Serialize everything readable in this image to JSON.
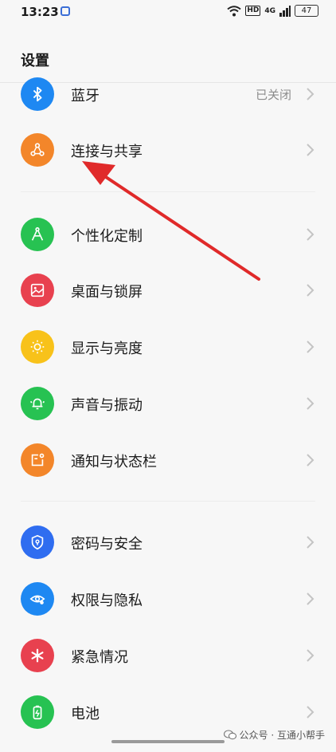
{
  "status": {
    "time": "13:23",
    "hd": "HD",
    "signal": "4G",
    "battery": "47"
  },
  "page": {
    "title": "设置"
  },
  "items": [
    {
      "id": "bluetooth",
      "label": "蓝牙",
      "value": "已关闭",
      "color": "#1e88f2",
      "icon": "bluetooth-icon"
    },
    {
      "id": "connection",
      "label": "连接与共享",
      "value": "",
      "color": "#f3862a",
      "icon": "share-network-icon"
    },
    {
      "id": "personalize",
      "label": "个性化定制",
      "value": "",
      "color": "#27c252",
      "icon": "compass-icon"
    },
    {
      "id": "wallpaper",
      "label": "桌面与锁屏",
      "value": "",
      "color": "#e8414f",
      "icon": "picture-icon"
    },
    {
      "id": "display",
      "label": "显示与亮度",
      "value": "",
      "color": "#f8c21a",
      "icon": "sun-icon"
    },
    {
      "id": "sound",
      "label": "声音与振动",
      "value": "",
      "color": "#27c252",
      "icon": "bell-icon"
    },
    {
      "id": "notify",
      "label": "通知与状态栏",
      "value": "",
      "color": "#f3862a",
      "icon": "notification-icon"
    },
    {
      "id": "security",
      "label": "密码与安全",
      "value": "",
      "color": "#2f6df0",
      "icon": "shield-icon"
    },
    {
      "id": "privacy",
      "label": "权限与隐私",
      "value": "",
      "color": "#1e88f2",
      "icon": "eye-icon"
    },
    {
      "id": "emergency",
      "label": "紧急情况",
      "value": "",
      "color": "#e8414f",
      "icon": "asterisk-icon"
    },
    {
      "id": "battery",
      "label": "电池",
      "value": "",
      "color": "#27c252",
      "icon": "battery-icon"
    }
  ],
  "watermark": {
    "text": "公众号 · 互通小帮手"
  }
}
